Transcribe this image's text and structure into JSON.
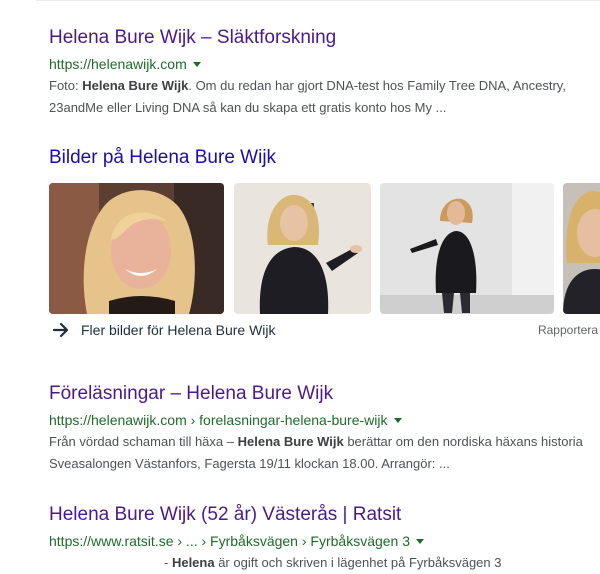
{
  "results": [
    {
      "title": "Helena Bure Wijk – Släktforskning",
      "url": "https://helenawijk.com",
      "snippet_pre": "Foto: ",
      "snippet_bold": "Helena Bure Wijk",
      "snippet_post": ". Om du redan har gjort DNA-test hos Family Tree DNA, Ancestry,",
      "snippet_line2": "23andMe eller Living DNA så kan du skapa ett gratis konto hos My ..."
    },
    {
      "title": "Föreläsningar – Helena Bure Wijk",
      "url": "https://helenawijk.com › forelasningar-helena-bure-wijk",
      "snippet_pre": "Från vördad schaman till häxa – ",
      "snippet_bold": "Helena Bure Wijk",
      "snippet_post": " berättar om den nordiska häxans historia",
      "snippet_line2": "Sveasalongen Västanfors, Fagersta 19/11 klockan 18.00. Arrangör: ..."
    },
    {
      "title": "Helena Bure Wijk (52 år) Västerås | Ratsit",
      "url": "https://www.ratsit.se › ... › Fyrbåksvägen › Fyrbåksvägen 3",
      "snippet_pre": "- ",
      "snippet_bold": "Helena",
      "snippet_post": " är ogift och skriven i lägenhet på Fyrbåksvägen 3",
      "snippet_line2": ""
    }
  ],
  "images_section": {
    "heading": "Bilder på Helena Bure Wijk",
    "more_label": "Fler bilder för Helena Bure Wijk",
    "report_label": "Rapportera"
  },
  "colors": {
    "visited_link": "#4a1a8c",
    "link": "#1a0dab",
    "url_green": "#1e6b2b",
    "snippet": "#4d5156"
  }
}
